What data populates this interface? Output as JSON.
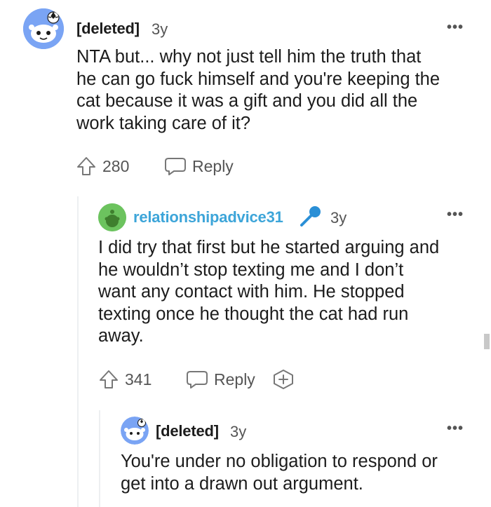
{
  "comments": [
    {
      "author": "[deleted]",
      "age": "3y",
      "text": "NTA but... why not just tell him the truth that he can go fuck himself and you're keeping the cat because it was a gift and you did all the work taking care of it?",
      "lines": [
        "NTA but... why not just tell him the truth that",
        "he can go fuck himself and you're keeping the",
        "cat because it was a gift and you did all the",
        "work taking care of it?"
      ],
      "score": "280",
      "reply_label": "Reply",
      "more": "•••"
    },
    {
      "author": "relationshipadvice31",
      "age": "3y",
      "lines": [
        "I did try that first but he started arguing and",
        "he wouldn’t stop texting me and I don’t",
        "want any contact with him. He stopped",
        "texting once he thought the cat had run",
        "away."
      ],
      "score": "341",
      "reply_label": "Reply",
      "more": "•••",
      "colors": {
        "author": "#3da5d9",
        "mic": "#2a8fd6"
      }
    },
    {
      "author": "[deleted]",
      "age": "3y",
      "lines": [
        "You're under no obligation to respond or",
        "get into a drawn out argument."
      ],
      "more": "•••"
    }
  ]
}
